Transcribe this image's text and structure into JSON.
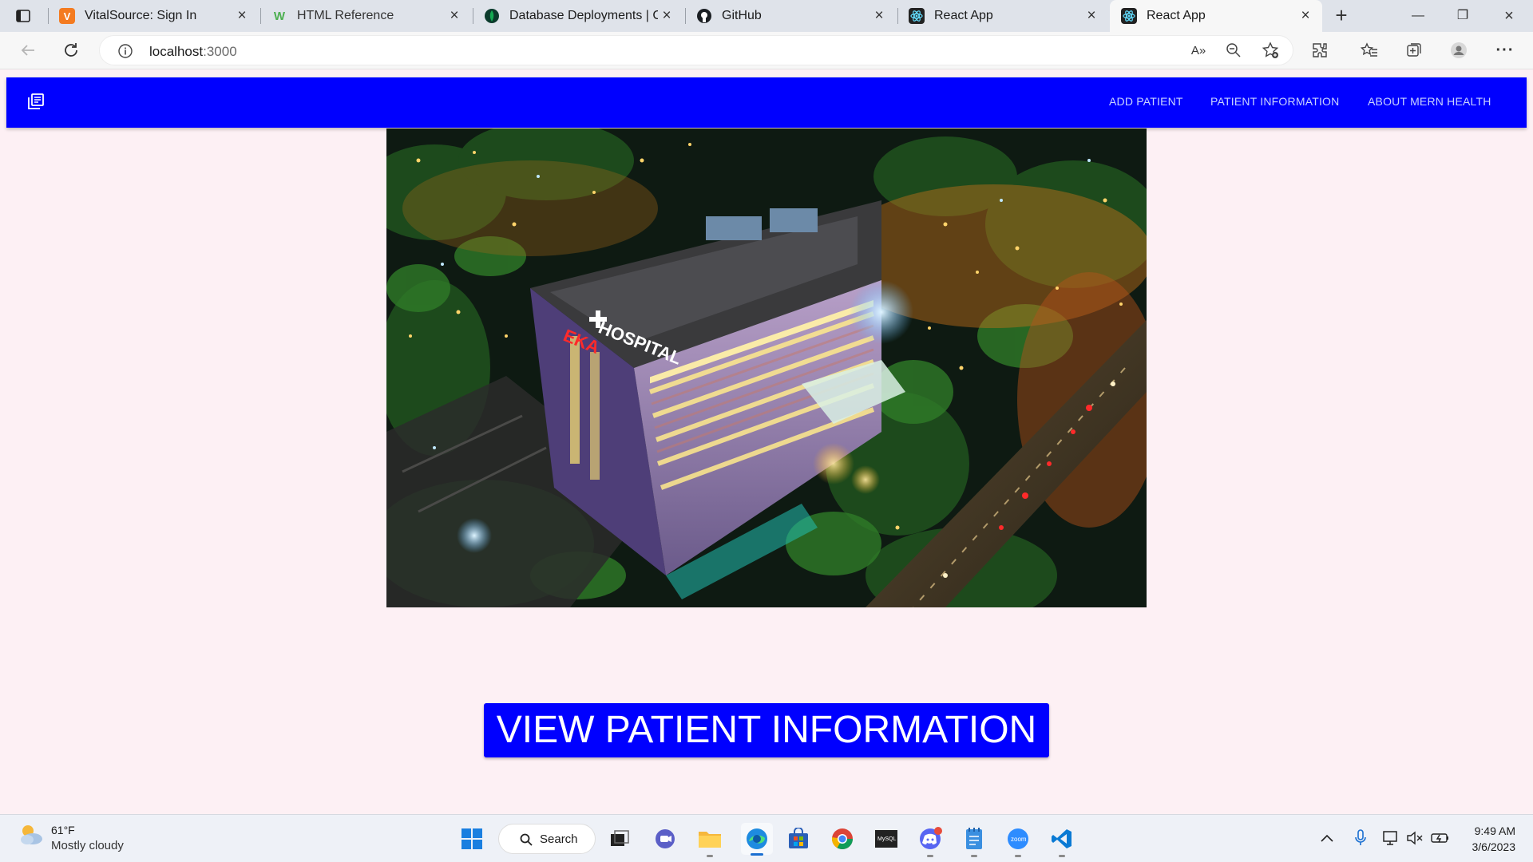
{
  "browser": {
    "tabs": [
      {
        "title": "VitalSource: Sign In",
        "favicon": "vitalsource-icon",
        "active": false
      },
      {
        "title": "HTML Reference",
        "favicon": "w3-icon",
        "active": false
      },
      {
        "title": "Database Deployments | Clo",
        "favicon": "mongodb-icon",
        "active": false
      },
      {
        "title": "GitHub",
        "favicon": "github-icon",
        "active": false
      },
      {
        "title": "React App",
        "favicon": "react-icon",
        "active": false
      },
      {
        "title": "React App",
        "favicon": "react-icon",
        "active": true
      }
    ],
    "address": {
      "host": "localhost",
      "port": ":3000"
    }
  },
  "app": {
    "nav_links": [
      "ADD PATIENT",
      "PATIENT INFORMATION",
      "ABOUT MERN HEALTH"
    ],
    "hero_sign": "EKA HOSPITAL",
    "cta_label": "VIEW PATIENT INFORMATION",
    "colors": {
      "primary": "#0000ff",
      "page_bg": "#fdf0f4"
    }
  },
  "taskbar": {
    "weather": {
      "temp": "61°F",
      "condition": "Mostly cloudy"
    },
    "search_label": "Search",
    "clock": {
      "time": "9:49 AM",
      "date": "3/6/2023"
    }
  }
}
